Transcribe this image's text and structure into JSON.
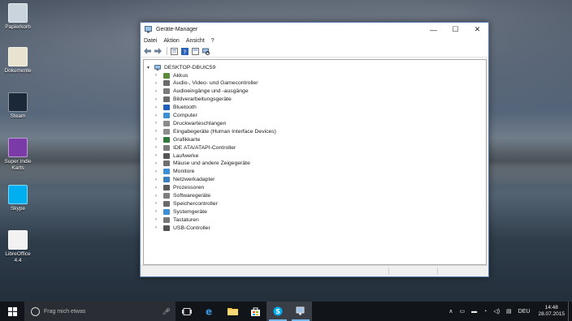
{
  "desktop": {
    "icons": [
      {
        "label": "Papierkorb",
        "icon": "recycle-bin-icon",
        "color": "#c9d4dc"
      },
      {
        "label": "Dokumente",
        "icon": "documents-icon",
        "color": "#e8e2d0"
      },
      {
        "label": "Steam",
        "icon": "steam-icon",
        "color": "#1b2838"
      },
      {
        "label": "Super Indie Karts",
        "icon": "game-icon",
        "color": "#7a3aa8"
      },
      {
        "label": "Skype",
        "icon": "skype-icon",
        "color": "#00aff0"
      },
      {
        "label": "LibreOffice 4.4",
        "icon": "libreoffice-icon",
        "color": "#f2f2f2"
      }
    ]
  },
  "window": {
    "title": "Geräte-Manager",
    "minimize": "—",
    "maximize": "☐",
    "close": "✕",
    "menu": [
      "Datei",
      "Aktion",
      "Ansicht",
      "?"
    ],
    "toolbar": [
      "back-arrow-icon",
      "forward-arrow-icon",
      "properties-icon",
      "help-icon",
      "view-icon",
      "computer-icon"
    ],
    "tree": {
      "root": "DESKTOP-DBUIC59",
      "items": [
        {
          "label": "Akkus",
          "icon": "battery-icon",
          "color": "#5a8a3a"
        },
        {
          "label": "Audio-, Video- und Gamecontroller",
          "icon": "speaker-icon",
          "color": "#6b6b6b"
        },
        {
          "label": "Audioeingänge und -ausgänge",
          "icon": "audio-io-icon",
          "color": "#7b7b7b"
        },
        {
          "label": "Bildverarbeitungsgeräte",
          "icon": "camera-icon",
          "color": "#6a6a6a"
        },
        {
          "label": "Bluetooth",
          "icon": "bluetooth-icon",
          "color": "#1f5fbf"
        },
        {
          "label": "Computer",
          "icon": "computer-icon",
          "color": "#3a8fd6"
        },
        {
          "label": "Druckwarteschlangen",
          "icon": "printer-icon",
          "color": "#8a8a8a"
        },
        {
          "label": "Eingabegeräte (Human Interface Devices)",
          "icon": "hid-icon",
          "color": "#8c8c8c"
        },
        {
          "label": "Grafikkarte",
          "icon": "display-adapter-icon",
          "color": "#2f7a3a"
        },
        {
          "label": "IDE ATA/ATAPI-Controller",
          "icon": "ide-icon",
          "color": "#7c7c7c"
        },
        {
          "label": "Laufwerke",
          "icon": "drive-icon",
          "color": "#555555"
        },
        {
          "label": "Mäuse und andere Zeigegeräte",
          "icon": "mouse-icon",
          "color": "#6f6f6f"
        },
        {
          "label": "Monitore",
          "icon": "monitor-icon",
          "color": "#3a8fd6"
        },
        {
          "label": "Netzwerkadapter",
          "icon": "network-icon",
          "color": "#3a7fc0"
        },
        {
          "label": "Prozessoren",
          "icon": "processor-icon",
          "color": "#5a5a5a"
        },
        {
          "label": "Softwaregeräte",
          "icon": "software-device-icon",
          "color": "#7f7f7f"
        },
        {
          "label": "Speichercontroller",
          "icon": "storage-controller-icon",
          "color": "#6a6a6a"
        },
        {
          "label": "Systemgeräte",
          "icon": "system-device-icon",
          "color": "#3a8fd6"
        },
        {
          "label": "Tastaturen",
          "icon": "keyboard-icon",
          "color": "#777777"
        },
        {
          "label": "USB-Controller",
          "icon": "usb-icon",
          "color": "#555555"
        }
      ]
    }
  },
  "taskbar": {
    "search_placeholder": "Frag mich etwas",
    "apps": [
      "task-view-icon",
      "edge-icon",
      "file-explorer-icon",
      "store-icon",
      "skype-icon",
      "device-manager-icon"
    ],
    "language": "DEU",
    "time": "14:48",
    "date": "28.07.2015"
  }
}
